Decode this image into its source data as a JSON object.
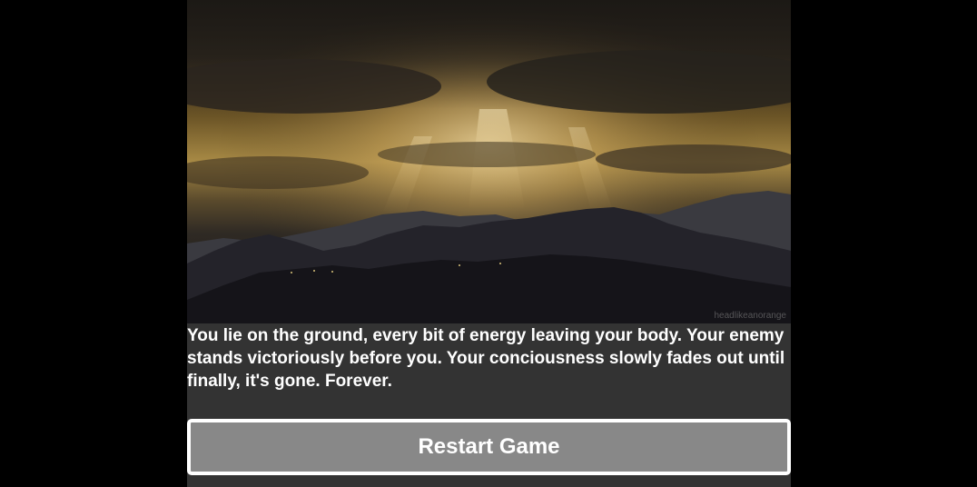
{
  "scene": {
    "image_subject": "mountains-at-dusk",
    "watermark": "headlikeanorange"
  },
  "story": {
    "text": "You lie on the ground, every bit of energy leaving your body. Your enemy stands victoriously before you. Your conciousness slowly fades out until finally, it's gone. Forever."
  },
  "controls": {
    "restart_label": "Restart Game"
  },
  "colors": {
    "page_background": "#000000",
    "panel_background": "#333333",
    "button_background": "#888888",
    "button_border": "#ffffff",
    "text": "#ffffff"
  }
}
